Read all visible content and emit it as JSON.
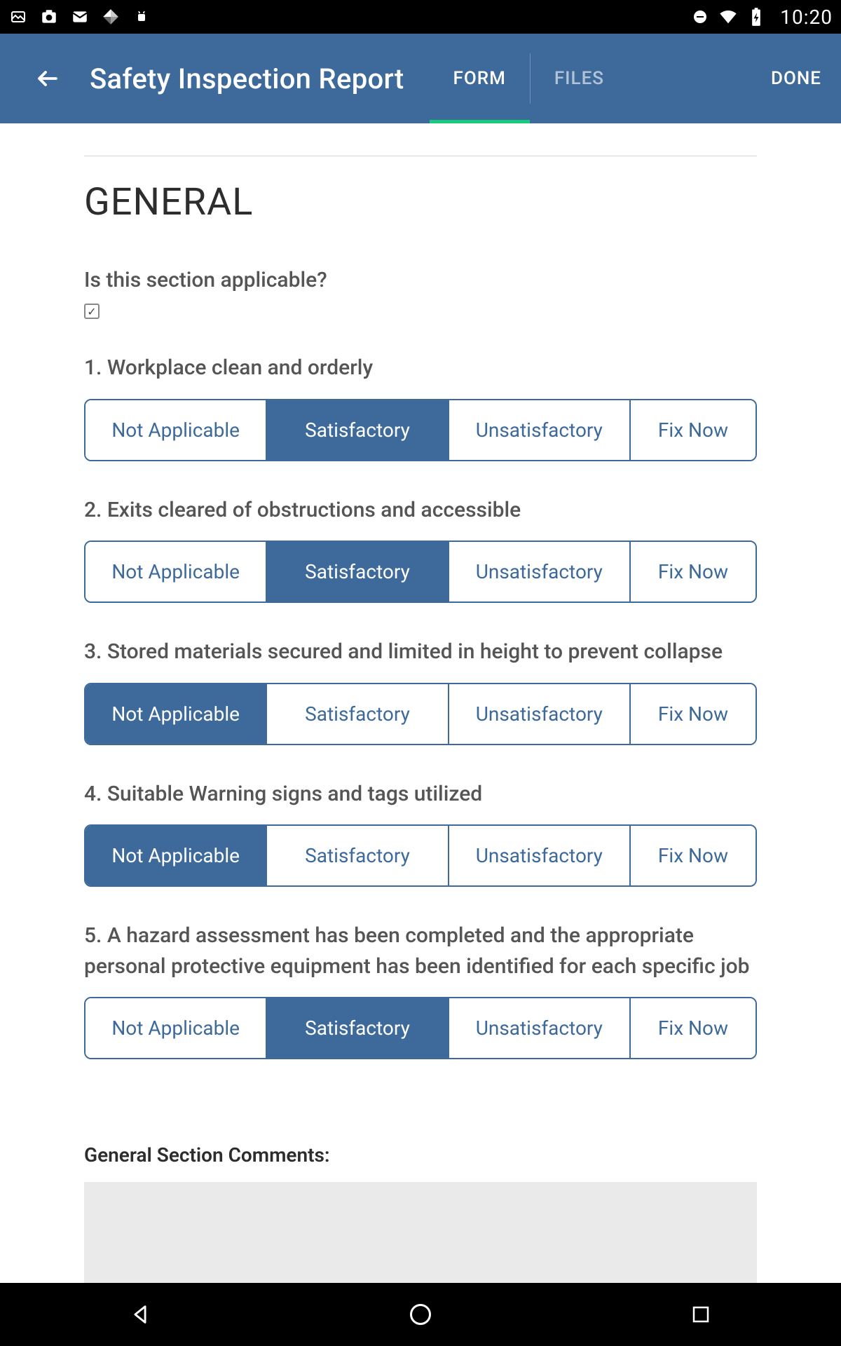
{
  "status": {
    "time": "10:20"
  },
  "appbar": {
    "title": "Safety Inspection Report",
    "tab_form": "FORM",
    "tab_files": "FILES",
    "done": "DONE"
  },
  "section": {
    "title": "GENERAL",
    "applicable_label": "Is this section applicable?",
    "comments_label": "General Section Comments:"
  },
  "options": {
    "na": "Not Applicable",
    "sat": "Satisfactory",
    "unsat": "Unsatisfactory",
    "fix": "Fix Now"
  },
  "questions": [
    {
      "label": "1. Workplace clean and orderly",
      "selected": "sat"
    },
    {
      "label": "2. Exits cleared of obstructions and accessible",
      "selected": "sat"
    },
    {
      "label": "3. Stored materials secured and limited in height to prevent collapse",
      "selected": "na"
    },
    {
      "label": "4. Suitable Warning signs and tags utilized",
      "selected": "na"
    },
    {
      "label": "5. A hazard assessment has been completed and the appropriate personal protective equipment has been identified for each specific job",
      "selected": "sat"
    }
  ]
}
